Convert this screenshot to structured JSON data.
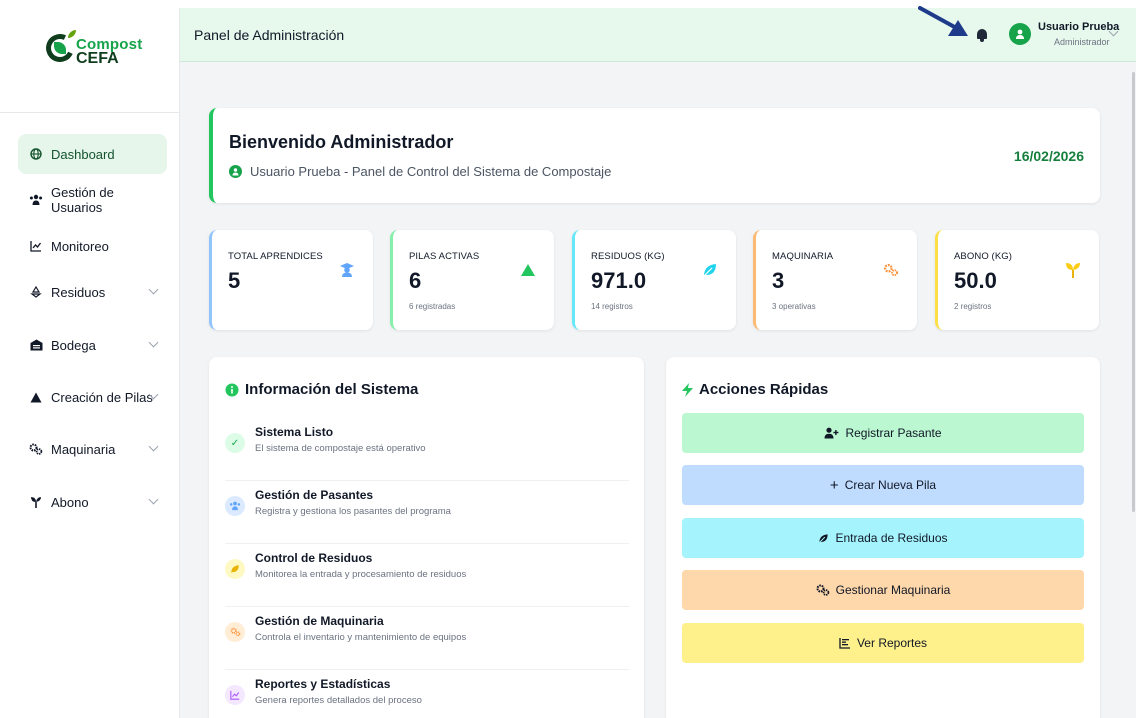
{
  "logo": {
    "line1": "Compost",
    "line2": "CEFA"
  },
  "sidebar": {
    "items": [
      {
        "label": "Dashboard",
        "icon": "globe-icon",
        "active": true,
        "expandable": false
      },
      {
        "label": "Gestión de Usuarios",
        "icon": "users-icon",
        "active": false,
        "expandable": false
      },
      {
        "label": "Monitoreo",
        "icon": "chart-line-icon",
        "active": false,
        "expandable": false
      },
      {
        "label": "Residuos",
        "icon": "recycle-icon",
        "active": false,
        "expandable": true
      },
      {
        "label": "Bodega",
        "icon": "warehouse-icon",
        "active": false,
        "expandable": true
      },
      {
        "label": "Creación de Pilas",
        "icon": "mountain-icon",
        "active": false,
        "expandable": true
      },
      {
        "label": "Maquinaria",
        "icon": "cogs-icon",
        "active": false,
        "expandable": true
      },
      {
        "label": "Abono",
        "icon": "seedling-icon",
        "active": false,
        "expandable": true
      }
    ]
  },
  "header": {
    "title": "Panel de Administración",
    "user_name": "Usuario Prueba",
    "user_role": "Administrador"
  },
  "welcome": {
    "title": "Bienvenido Administrador",
    "subtitle": "Usuario Prueba - Panel de Control del Sistema de Compostaje",
    "date": "16/02/2026"
  },
  "stats": [
    {
      "label": "TOTAL APRENDICES",
      "value": "5",
      "note": "",
      "icon": "graduate-icon",
      "color": "#60a5fa"
    },
    {
      "label": "PILAS ACTIVAS",
      "value": "6",
      "note": "6 registradas",
      "icon": "mountain-icon",
      "color": "#22c55e"
    },
    {
      "label": "RESIDUOS (KG)",
      "value": "971.0",
      "note": "14 registros",
      "icon": "leaf-icon",
      "color": "#22d3ee"
    },
    {
      "label": "MAQUINARIA",
      "value": "3",
      "note": "3 operativas",
      "icon": "cogs-icon",
      "color": "#fb923c"
    },
    {
      "label": "ABONO (KG)",
      "value": "50.0",
      "note": "2 registros",
      "icon": "seedling-icon",
      "color": "#facc15"
    }
  ],
  "info": {
    "title": "Información del Sistema",
    "rows": [
      {
        "title": "Sistema Listo",
        "desc": "El sistema de compostaje está operativo",
        "icon": "check-icon"
      },
      {
        "title": "Gestión de Pasantes",
        "desc": "Registra y gestiona los pasantes del programa",
        "icon": "users-icon"
      },
      {
        "title": "Control de Residuos",
        "desc": "Monitorea la entrada y procesamiento de residuos",
        "icon": "leaf-icon"
      },
      {
        "title": "Gestión de Maquinaria",
        "desc": "Controla el inventario y mantenimiento de equipos",
        "icon": "cogs-icon"
      },
      {
        "title": "Reportes y Estadísticas",
        "desc": "Genera reportes detallados del proceso",
        "icon": "chart-line-icon"
      }
    ]
  },
  "actions": {
    "title": "Acciones Rápidas",
    "buttons": [
      {
        "label": "Registrar Pasante",
        "icon": "user-plus-icon",
        "color": "#bbf7d0"
      },
      {
        "label": "Crear Nueva Pila",
        "icon": "plus-icon",
        "color": "#bfdbfe"
      },
      {
        "label": "Entrada de Residuos",
        "icon": "leaf-icon",
        "color": "#a5f3fc"
      },
      {
        "label": "Gestionar Maquinaria",
        "icon": "cogs-icon",
        "color": "#fed7aa"
      },
      {
        "label": "Ver Reportes",
        "icon": "chart-bar-icon",
        "color": "#fef08a"
      }
    ]
  }
}
